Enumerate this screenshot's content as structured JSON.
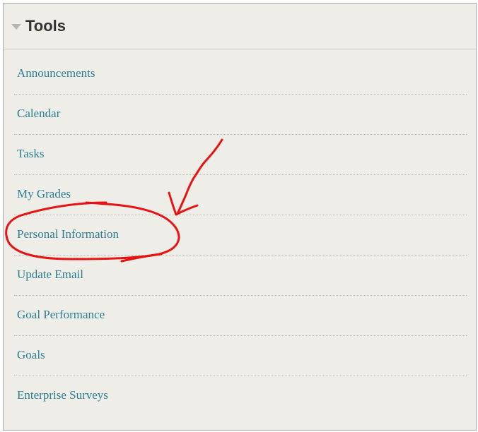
{
  "panel": {
    "title": "Tools",
    "collapse_icon": "triangle-down-icon"
  },
  "tools": {
    "items": [
      {
        "label": "Announcements"
      },
      {
        "label": "Calendar"
      },
      {
        "label": "Tasks"
      },
      {
        "label": "My Grades"
      },
      {
        "label": "Personal Information"
      },
      {
        "label": "Update Email"
      },
      {
        "label": "Goal Performance"
      },
      {
        "label": "Goals"
      },
      {
        "label": "Enterprise Surveys"
      }
    ]
  },
  "colors": {
    "panel_background": "#efede8",
    "link": "#2b7f93",
    "title": "#333333",
    "annotation": "#e81212"
  }
}
